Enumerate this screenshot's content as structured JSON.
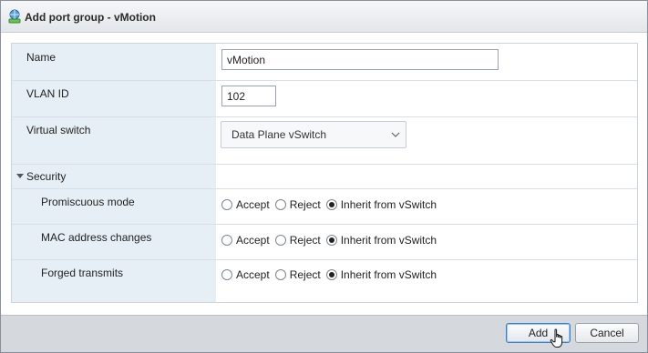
{
  "window": {
    "title": "Add port group - vMotion"
  },
  "fields": {
    "name": {
      "label": "Name",
      "value": "vMotion"
    },
    "vlan": {
      "label": "VLAN ID",
      "value": "102"
    },
    "vswitch": {
      "label": "Virtual switch",
      "value": "Data Plane vSwitch"
    }
  },
  "security": {
    "header": "Security",
    "options": [
      "Accept",
      "Reject",
      "Inherit from vSwitch"
    ],
    "rows": [
      {
        "label": "Promiscuous mode",
        "selected": "Inherit from vSwitch"
      },
      {
        "label": "MAC address changes",
        "selected": "Inherit from vSwitch"
      },
      {
        "label": "Forged transmits",
        "selected": "Inherit from vSwitch"
      }
    ]
  },
  "buttons": {
    "add": "Add",
    "cancel": "Cancel"
  },
  "colors": {
    "label_column_bg": "#e6eff6",
    "primary_button_border": "#3f7fc0",
    "footer_bg": "#d5d9de"
  }
}
